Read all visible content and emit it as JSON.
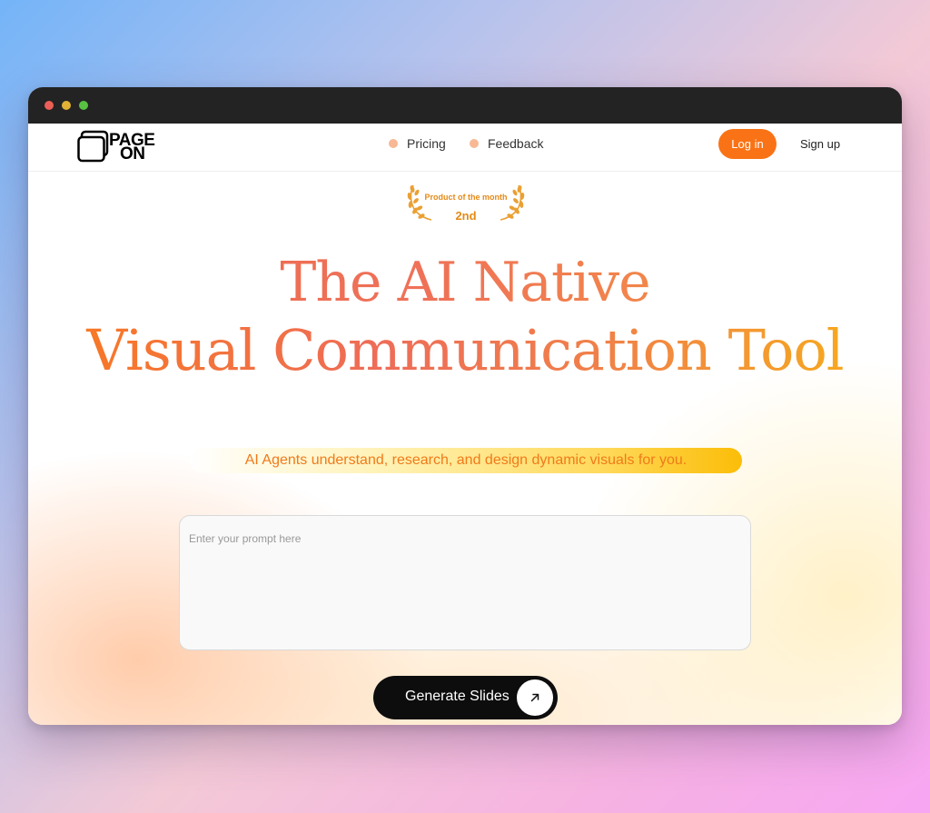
{
  "nav": {
    "logo_line1": "PAGE",
    "logo_line2": "ON",
    "links": [
      {
        "label": "Pricing"
      },
      {
        "label": "Feedback"
      }
    ],
    "login_label": "Log in",
    "signup_label": "Sign up"
  },
  "award": {
    "title": "Product of the month",
    "rank": "2nd"
  },
  "hero": {
    "line1": "The AI Native",
    "line2": "Visual Communication Tool",
    "subtitle": "AI Agents understand, research, and design dynamic visuals for you."
  },
  "prompt": {
    "placeholder": "Enter your prompt here",
    "value": ""
  },
  "generate": {
    "label": "Generate Slides",
    "icon": "arrow-up-right-icon"
  },
  "colors": {
    "accent": "#f97316",
    "award": "#e58a16",
    "bullet": "#f8b894"
  }
}
